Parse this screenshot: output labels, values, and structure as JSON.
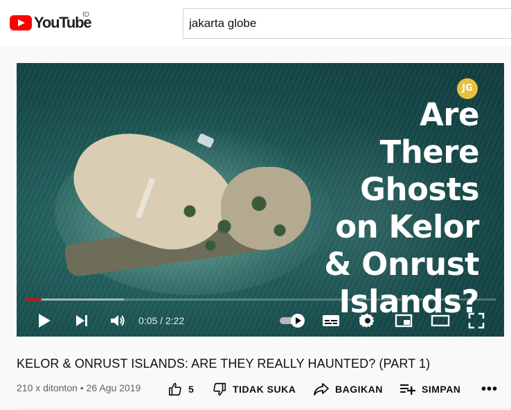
{
  "header": {
    "logo_text": "YouTube",
    "region": "ID",
    "search_value": "jakarta globe"
  },
  "player": {
    "badge_text": "JG",
    "headline": [
      "Are",
      "There",
      "Ghosts",
      "on Kelor",
      "& Onrust",
      "Islands?"
    ],
    "time_display": "0:05 / 2:22",
    "progress": 0.036,
    "buffered": 0.21,
    "controls": [
      "play-icon",
      "next-icon",
      "volume-icon",
      "autoplay-toggle",
      "subtitles-icon",
      "settings-icon",
      "miniplayer-icon",
      "theater-icon",
      "fullscreen-icon"
    ]
  },
  "video": {
    "title": "KELOR & ONRUST ISLANDS: ARE THEY REALLY HAUNTED? (PART 1)",
    "meta": "210 x ditonton • 26 Agu 2019",
    "like_count": "5",
    "dislike_label": "TIDAK SUKA",
    "share_label": "BAGIKAN",
    "save_label": "SIMPAN",
    "more_label": "•••"
  }
}
